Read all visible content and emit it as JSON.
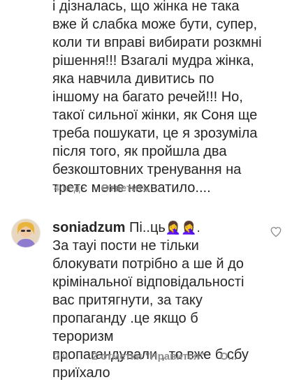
{
  "comments": [
    {
      "lines": [
        "і дізналась, що жінка не така",
        "вже й слабка може бути, супер,",
        "коли ти вправі вибирати розкмні",
        "рішення!!! Взагалі мудра жінка,",
        "яка навчила дивитись по",
        "іншому на багато речей!!! Но,",
        "такої сильної жінки, як Соня ще",
        "треба пошукати, це я зрозуміла",
        "після того, як пройшла два",
        "безкоштовних тренування на",
        "третє мене нехватило...."
      ],
      "time": "4 нед.",
      "reply_label": "Ответить"
    },
    {
      "username": "soniadzum",
      "first_text": "Пі..ць",
      "emoji": "🤦‍♀️🤦‍♀️.",
      "lines": [
        "За тауі пости не тільки",
        "блокувати потрібно а ше й до",
        "крімінальної відповідальності",
        "вас притягнути, за таку",
        "пропаганду .це якщо б тероризм",
        "пропагандували , то вже б сбу",
        "приїхало"
      ],
      "time": "2 ч.",
      "likes_label": "2 отметки \"Нравится\"",
      "reply_label": "О..."
    }
  ],
  "icons": {
    "heart": "heart-icon",
    "avatar": "avatar"
  },
  "colors": {
    "text": "#262626",
    "meta": "#8e8e8e"
  }
}
